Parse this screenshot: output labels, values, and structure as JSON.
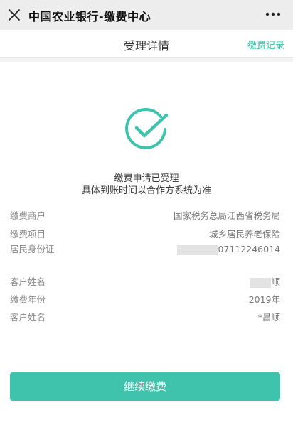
{
  "app": {
    "title": "中国农业银行-缴费中心"
  },
  "subheader": {
    "title": "受理详情",
    "records_link": "缴费记录"
  },
  "result": {
    "line1": "缴费申请已受理",
    "line2": "具体到账时间以合作方系统为准"
  },
  "details": [
    {
      "label": "缴费商户",
      "value": "国家税务总局江西省税务局"
    },
    {
      "label": "缴费项目",
      "value": "城乡居民养老保险"
    },
    {
      "label": "居民身份证",
      "value": "07112246014"
    },
    {
      "label": "客户姓名",
      "value": "顺"
    },
    {
      "label": "缴费年份",
      "value": "2019年"
    },
    {
      "label": "客户姓名",
      "value": "*昌顺"
    }
  ],
  "actions": {
    "continue_label": "继续缴费"
  },
  "colors": {
    "accent": "#3fc3ad",
    "link": "#35c3aa"
  },
  "icons": {
    "close": "close-icon",
    "more": "more-icon",
    "success": "check-circle-icon"
  }
}
